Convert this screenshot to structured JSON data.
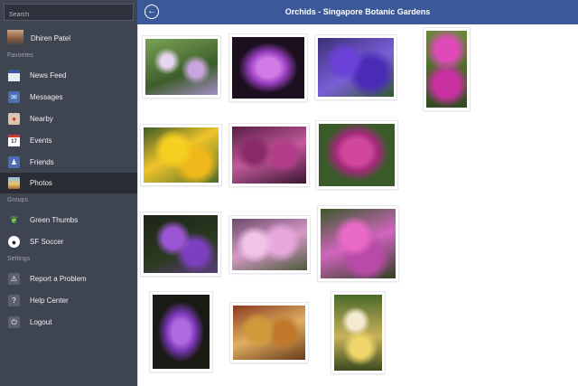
{
  "sidebar": {
    "search_placeholder": "Search",
    "profile_name": "Dhiren Patel",
    "favorites_header": "Favorites",
    "favorites": [
      {
        "label": "News Feed",
        "icon": "news-feed-icon"
      },
      {
        "label": "Messages",
        "icon": "messages-icon"
      },
      {
        "label": "Nearby",
        "icon": "nearby-icon"
      },
      {
        "label": "Events",
        "icon": "events-icon",
        "icon_text": "17"
      },
      {
        "label": "Friends",
        "icon": "friends-icon"
      },
      {
        "label": "Photos",
        "icon": "photos-icon",
        "active": true
      }
    ],
    "groups_header": "Groups",
    "groups": [
      {
        "label": "Green Thumbs",
        "icon": "leaf-icon"
      },
      {
        "label": "SF Soccer",
        "icon": "soccer-ball-icon"
      }
    ],
    "settings_header": "Settings",
    "settings": [
      {
        "label": "Report a Problem",
        "icon": "report-icon"
      },
      {
        "label": "Help Center",
        "icon": "help-icon"
      },
      {
        "label": "Logout",
        "icon": "logout-icon"
      }
    ]
  },
  "header": {
    "title": "Orchids - Singapore Botanic Gardens",
    "back_icon": "back-arrow-icon"
  },
  "colors": {
    "header_blue": "#3b5998",
    "sidebar_bg": "#3f4451",
    "sidebar_active": "#2a2d34"
  },
  "photos": [
    {
      "name": "orchid-photo-1",
      "desc": "white-lavender-orchids"
    },
    {
      "name": "orchid-photo-2",
      "desc": "purple-orchid-on-black"
    },
    {
      "name": "orchid-photo-3",
      "desc": "blue-violet-orchids"
    },
    {
      "name": "orchid-photo-4",
      "desc": "magenta-orchids-vertical"
    },
    {
      "name": "orchid-photo-5",
      "desc": "yellow-orchids"
    },
    {
      "name": "orchid-photo-6",
      "desc": "dark-purple-spotted-orchids"
    },
    {
      "name": "orchid-photo-7",
      "desc": "magenta-spotted-orchids"
    },
    {
      "name": "orchid-photo-8",
      "desc": "purple-orchids-dark"
    },
    {
      "name": "orchid-photo-9",
      "desc": "light-pink-orchids"
    },
    {
      "name": "orchid-photo-10",
      "desc": "pink-purple-orchids"
    },
    {
      "name": "orchid-photo-11",
      "desc": "purple-orchid-vertical"
    },
    {
      "name": "orchid-photo-12",
      "desc": "brown-spotted-orchids"
    },
    {
      "name": "orchid-photo-13",
      "desc": "yellow-white-orchids-vertical"
    }
  ]
}
